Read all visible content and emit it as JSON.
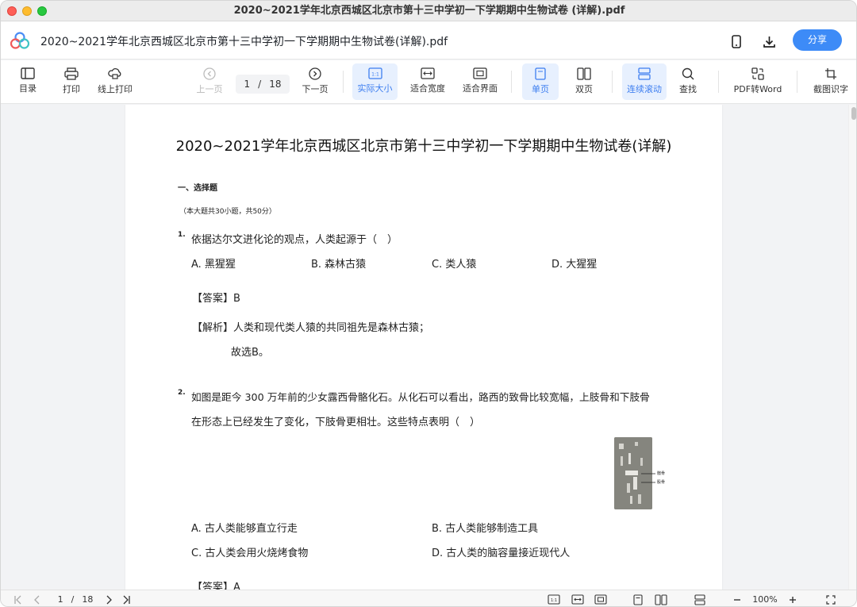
{
  "window": {
    "title": "2020~2021学年北京西城区北京市第十三中学初一下学期期中生物试卷 (详解).pdf"
  },
  "header": {
    "doc_title": "2020~2021学年北京西城区北京市第十三中学初一下学期期中生物试卷(详解).pdf",
    "share_label": "分享"
  },
  "toolbar": {
    "toc": "目录",
    "print": "打印",
    "online_print": "线上打印",
    "prev_page": "上一页",
    "current_page": "1",
    "page_sep": "/",
    "total_pages": "18",
    "next_page": "下一页",
    "actual_size": "实际大小",
    "fit_width": "适合宽度",
    "fit_screen": "适合界面",
    "single_page": "单页",
    "double_page": "双页",
    "continuous_scroll": "连续滚动",
    "find": "查找",
    "pdf_to_word": "PDF转Word",
    "ocr": "截图识字"
  },
  "document": {
    "title": "2020~2021学年北京西城区北京市第十三中学初一下学期期中生物试卷(详解)",
    "section_heading": "一、选择题",
    "section_note": "（本大题共30小题，共50分）",
    "questions": [
      {
        "number": "1.",
        "text": "依据达尔文进化论的观点，人类起源于（　）",
        "options": [
          "A. 黑猩猩",
          "B. 森林古猿",
          "C. 类人猿",
          "D. 大猩猩"
        ],
        "answer_label": "【答案】",
        "answer": "B",
        "analysis_label": "【解析】",
        "analysis": "人类和现代类人猿的共同祖先是森林古猿；",
        "conclusion": "故选B。"
      },
      {
        "number": "2.",
        "text_line1": "如图是距今 300 万年前的少女露西骨骼化石。从化石可以看出，路西的致骨比较宽幅，上肢骨和下肢骨",
        "text_line2": "在形态上已经发生了变化，下肢骨更相壮。这些特点表明（　）",
        "figure_labels": [
          "髋骨",
          "股骨"
        ],
        "options": [
          "A. 古人类能够直立行走",
          "B. 古人类能够制造工具",
          "C. 古人类会用火烧烤食物",
          "D. 古人类的脑容量接近现代人"
        ],
        "answer_label": "【答案】",
        "answer": "A"
      }
    ]
  },
  "bottombar": {
    "current_page": "1",
    "page_sep": "/",
    "total_pages": "18",
    "zoom": "100%"
  },
  "colors": {
    "accent": "#3d8bf7",
    "active_bg": "#e7f0fe",
    "active_text": "#3d7ef0"
  }
}
